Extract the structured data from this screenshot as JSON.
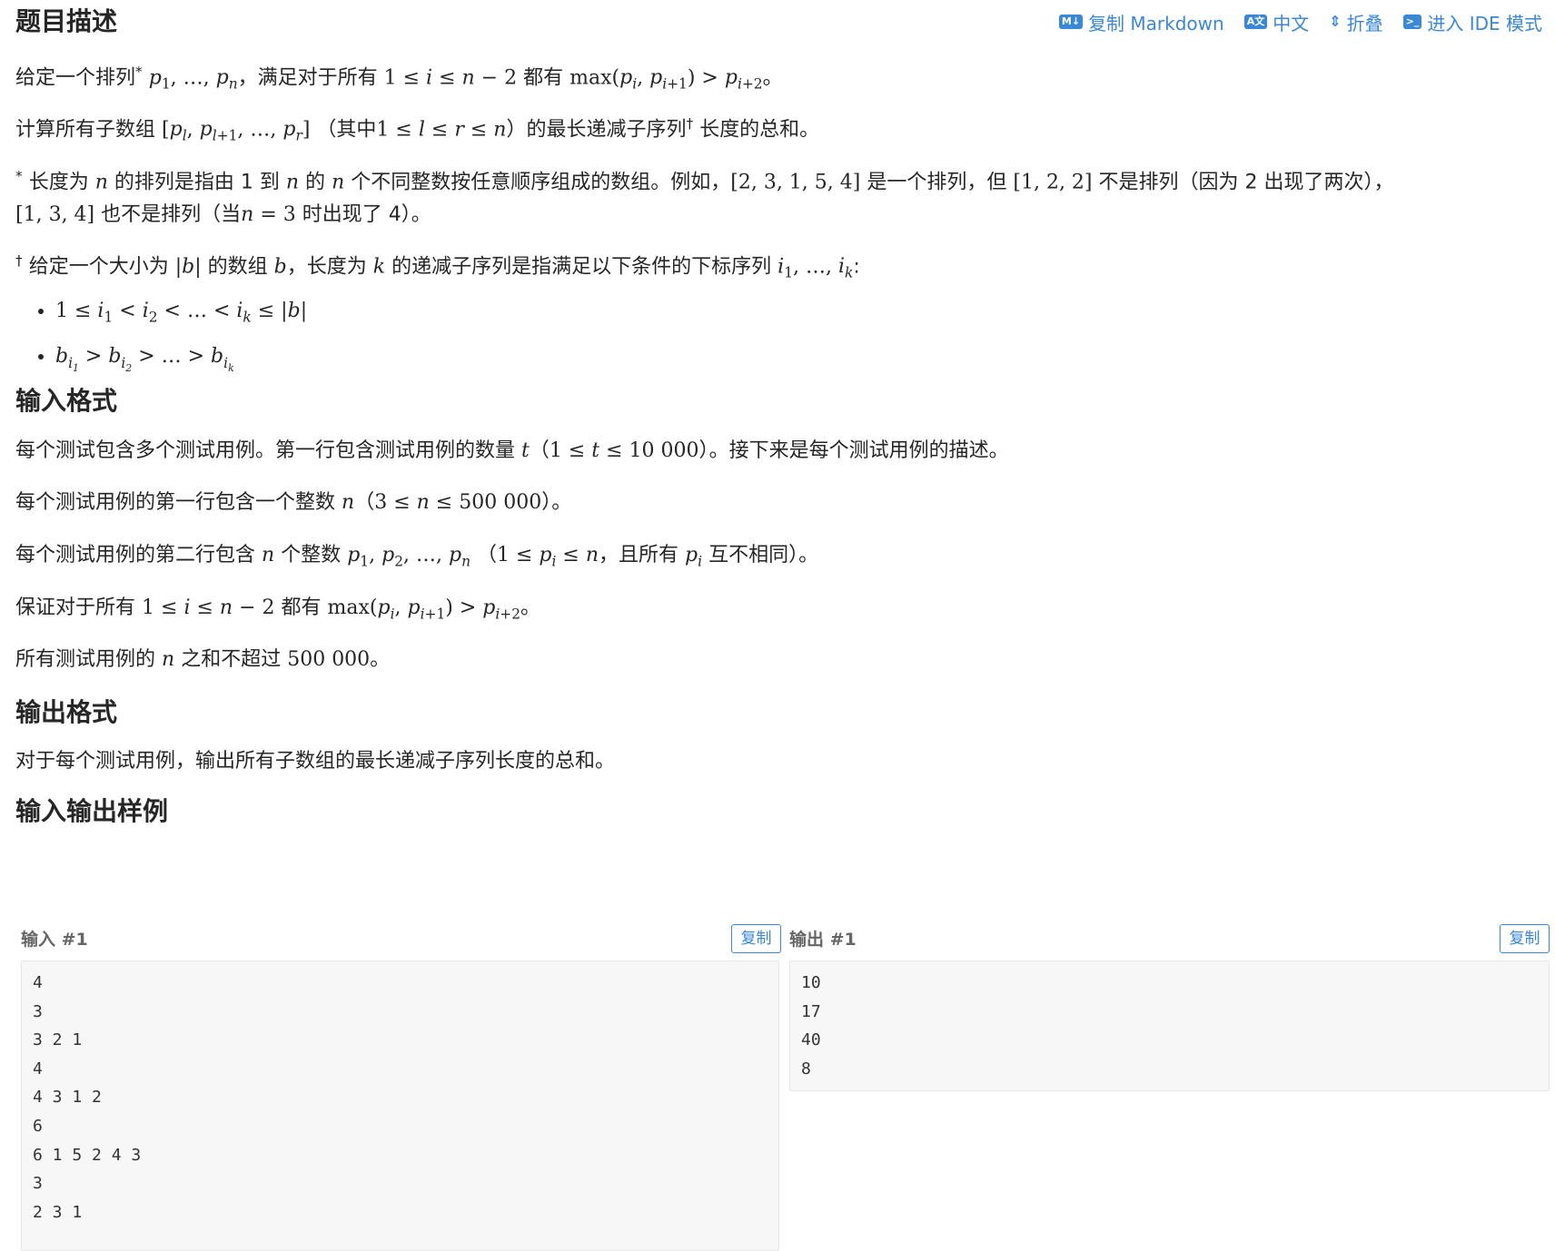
{
  "toolbar": {
    "copy_markdown": {
      "icon": "M↓",
      "label": "复制 Markdown"
    },
    "chinese": {
      "icon": "A文",
      "label": "中文"
    },
    "fold": {
      "icon": "⇕",
      "label": "折叠"
    },
    "ide": {
      "icon": ">_",
      "label": "进入 IDE 模式"
    }
  },
  "sections": {
    "description": "题目描述",
    "input_format": "输入格式",
    "output_format": "输出格式",
    "samples": "输入输出样例"
  },
  "description": {
    "p1_a": "给定一个排列",
    "p1_b": "，满足对于所有",
    "p1_c": "都有",
    "p2_a": "计算所有子数组",
    "p2_b": "（其中",
    "p2_c": "）的最长递减子序列",
    "p2_d": "长度的总和。",
    "fn1_a": "长度为",
    "fn1_b": "的排列是指由 1 到",
    "fn1_c": "的",
    "fn1_d": "个不同整数按任意顺序组成的数组。例如，",
    "fn1_e": "是一个排列，但",
    "fn1_f": "不是排列（因为 2 出现了两次），",
    "fn1_g": "也不是排列（当",
    "fn1_h": "时出现了 4）。",
    "fn2_a": "给定一个大小为",
    "fn2_b": "的数组",
    "fn2_c": "，长度为",
    "fn2_d": "的递减子序列是指满足以下条件的下标序列"
  },
  "input_format": {
    "l1_a": "每个测试包含多个测试用例。第一行包含测试用例的数量",
    "l1_b": "。接下来是每个测试用例的描述。",
    "l2_a": "每个测试用例的第一行包含一个整数",
    "l2_b": "。",
    "l3_a": "每个测试用例的第二行包含",
    "l3_b": "个整数",
    "l3_c": "，且所有",
    "l3_d": "互不相同）。",
    "l4_a": "保证对于所有",
    "l4_b": "都有",
    "l5_a": "所有测试用例的",
    "l5_b": "之和不超过",
    "l5_c": "。"
  },
  "output_format": {
    "text": "对于每个测试用例，输出所有子数组的最长递减子序列长度的总和。"
  },
  "samples": {
    "input_title": "输入 #1",
    "output_title": "输出 #1",
    "copy_label": "复制",
    "input_lines": [
      "4",
      "3",
      "3 2 1",
      "4",
      "4 3 1 2",
      "6",
      "6 1 5 2 4 3",
      "3",
      "2 3 1"
    ],
    "output_lines": [
      "10",
      "17",
      "40",
      "8"
    ]
  },
  "colors": {
    "accent": "#3a87d8",
    "code_bg": "#f7f7f7",
    "text": "#262626"
  }
}
